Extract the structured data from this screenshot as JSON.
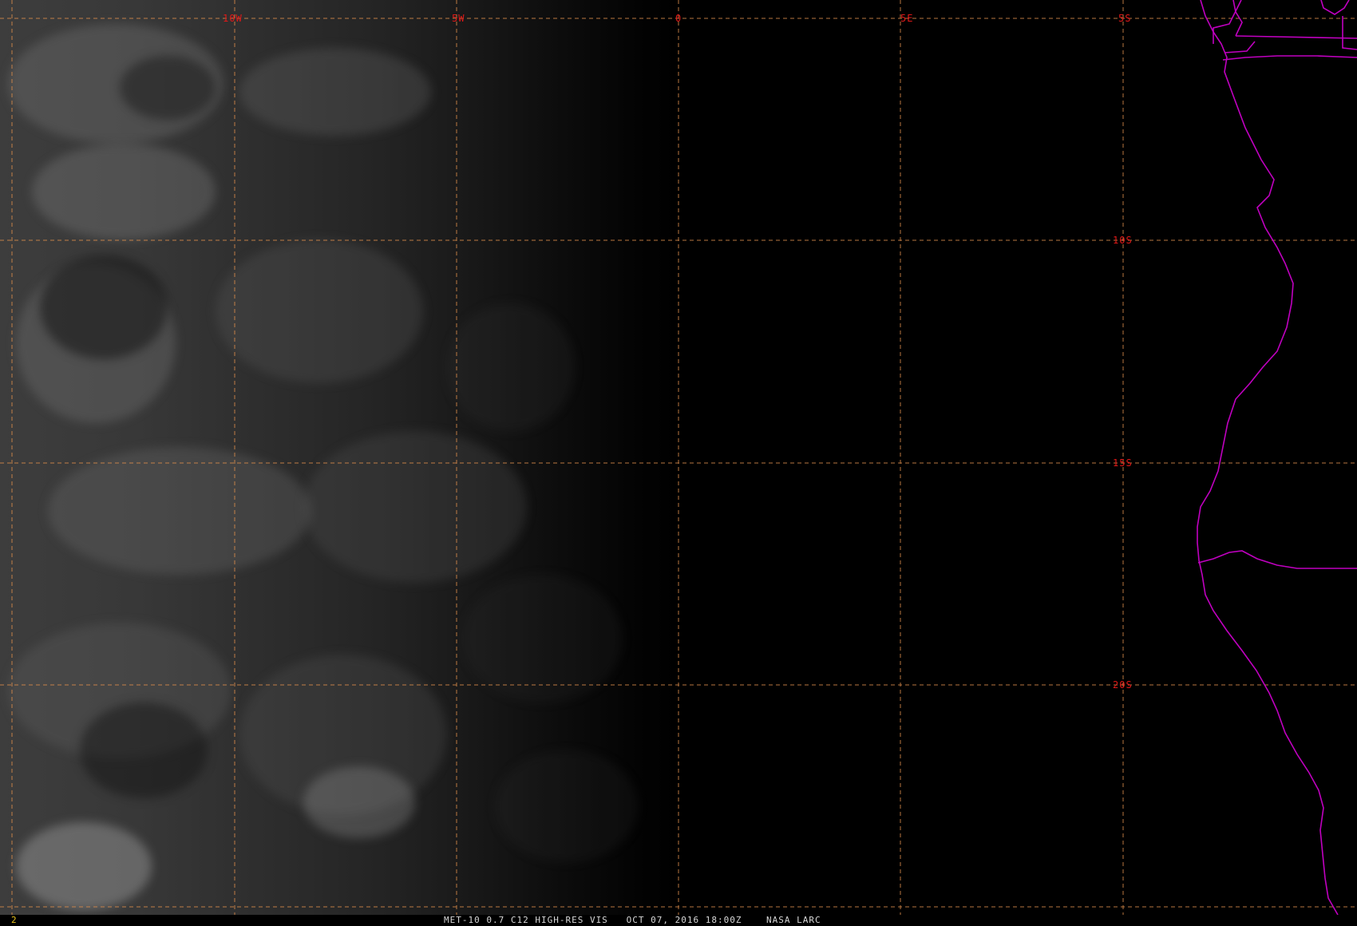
{
  "image": {
    "caption": "MET-10 0.7 C12 HIGH-RES VIS   OCT 07, 2016 18:00Z    NASA LARC",
    "frame_number": "2"
  },
  "grid": {
    "line_color": "#d98b4a",
    "label_color": "#e01818",
    "longitude_labels": [
      "10W",
      "5W",
      "0",
      "5E"
    ],
    "latitude_labels": [
      "5S",
      "10S",
      "15S",
      "20S"
    ]
  },
  "coastline": {
    "color": "#c000c0"
  }
}
